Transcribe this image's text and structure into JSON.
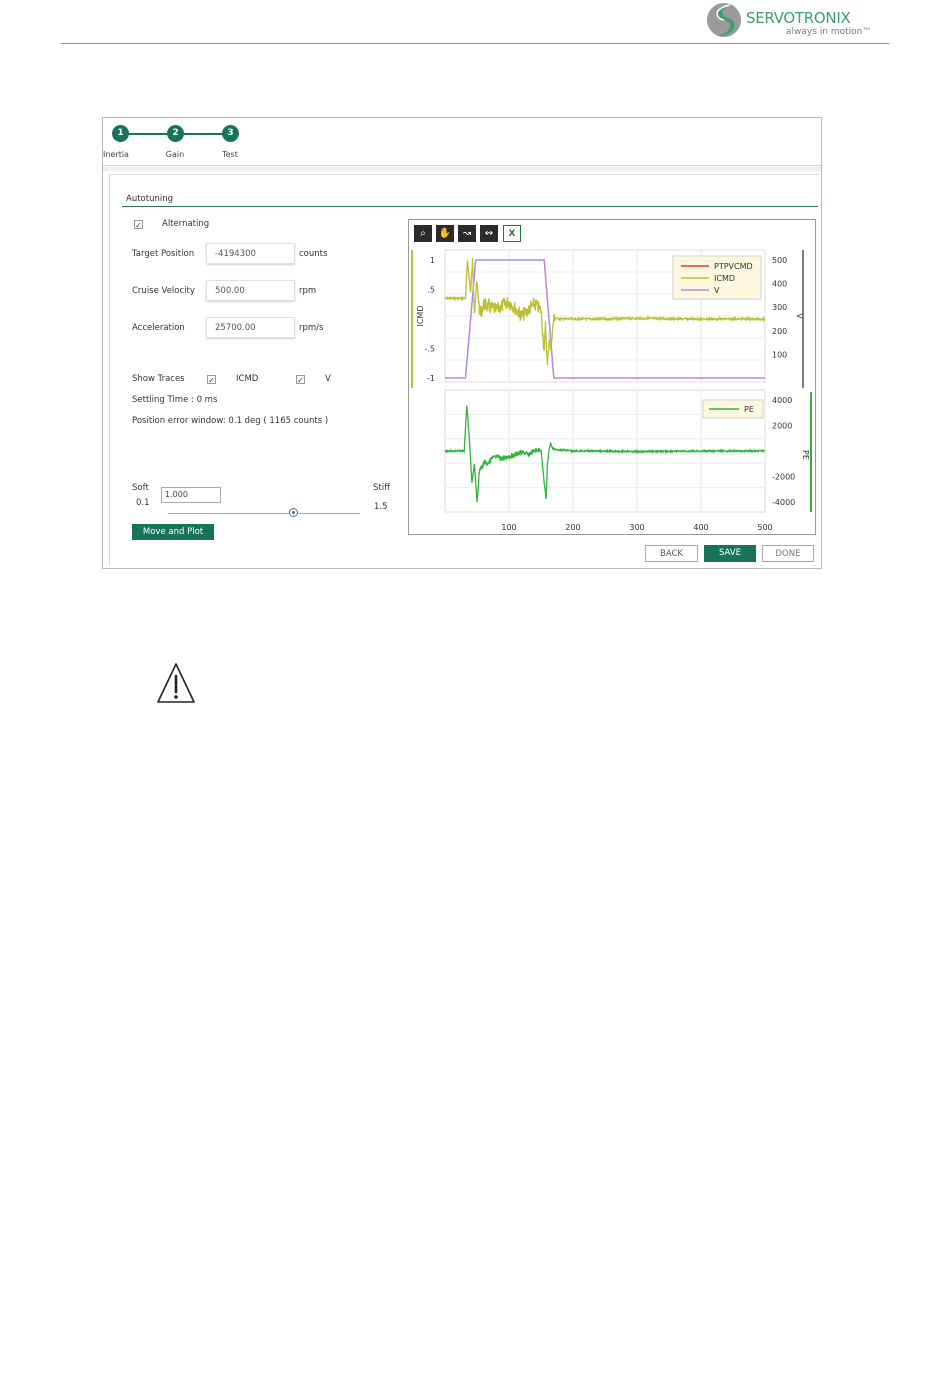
{
  "header": {
    "brand": "SERVOTRONIX",
    "tagline": "always in motion™",
    "colors": {
      "brand": "#3f9e6b",
      "accent": "#17745a"
    }
  },
  "wizard": {
    "steps": [
      {
        "number": "1",
        "label": "Inertia"
      },
      {
        "number": "2",
        "label": "Gain"
      },
      {
        "number": "3",
        "label": "Test"
      }
    ]
  },
  "autotuning": {
    "title": "Autotuning",
    "alternating": {
      "label": "Alternating",
      "checked": "✓"
    },
    "target_position": {
      "label": "Target Position",
      "value": "-4194300",
      "unit": "counts"
    },
    "cruise_velocity": {
      "label": "Cruise Velocity",
      "value": "500.00",
      "unit": "rpm"
    },
    "acceleration": {
      "label": "Acceleration",
      "value": "25700.00",
      "unit": "rpm/s"
    },
    "show_traces": {
      "label": "Show Traces",
      "icmd": {
        "label": "ICMD",
        "checked": "✓"
      },
      "v": {
        "label": "V",
        "checked": "✓"
      }
    },
    "settling_time": "Settling Time : 0 ms",
    "position_error_window": "Position error window: 0.1 deg ( 1165 counts )",
    "stiffness": {
      "soft_label": "Soft",
      "stiff_label": "Stiff",
      "min": "0.1",
      "max": "1.5",
      "value": "1.000",
      "slider_fraction": 0.65
    },
    "move_and_plot": "Move and Plot"
  },
  "chart_toolbar": {
    "icons": [
      "zoom-icon",
      "pan-hand-icon",
      "autoscale-icon",
      "fit-traces-icon",
      "excel-export-icon"
    ],
    "glyphs": [
      "⌕",
      "✋",
      "↝",
      "↭",
      "X"
    ]
  },
  "chart_data": [
    {
      "type": "line",
      "xlim": [
        0,
        500
      ],
      "ylabel": "ICMD",
      "ylim_left": [
        -1,
        1
      ],
      "left_ticks": [
        "1",
        ".5",
        "-.5",
        "-1"
      ],
      "y2label": "V",
      "ylim_right": [
        0,
        500
      ],
      "right_ticks": [
        "500",
        "400",
        "300",
        "200",
        "100"
      ],
      "legend_position": "top-right",
      "series": [
        {
          "name": "PTPVCMD",
          "color": "#e03a3a",
          "axis": "right",
          "x": [
            0,
            32,
            48,
            155,
            170,
            500
          ],
          "y": [
            0,
            0,
            500,
            500,
            0,
            0
          ]
        },
        {
          "name": "ICMD",
          "color": "#bcc034",
          "axis": "left",
          "x": [
            0,
            32,
            35,
            40,
            43,
            46,
            50,
            55,
            60,
            70,
            80,
            100,
            120,
            140,
            150,
            155,
            157,
            160,
            163,
            165,
            170,
            180,
            200,
            250,
            300,
            400,
            500
          ],
          "y": [
            0.35,
            0.35,
            1.0,
            0.45,
            0.95,
            0.2,
            0.6,
            0.05,
            0.25,
            0.2,
            0.15,
            0.3,
            0.05,
            0.25,
            0.15,
            -0.55,
            -0.1,
            -0.8,
            -0.3,
            -0.5,
            0.02,
            0.0,
            0.0,
            0.0,
            0.01,
            0.0,
            0.0
          ]
        },
        {
          "name": "V",
          "color": "#b48ee0",
          "axis": "right",
          "x": [
            0,
            32,
            48,
            155,
            170,
            500
          ],
          "y": [
            0,
            0,
            500,
            500,
            0,
            0
          ]
        }
      ]
    },
    {
      "type": "line",
      "xlim": [
        0,
        500
      ],
      "y2label": "PE",
      "ylim_right": [
        -4000,
        4000
      ],
      "right_ticks": [
        "4000",
        "2000",
        "-2000",
        "-4000"
      ],
      "x_ticks": [
        "100",
        "200",
        "300",
        "400",
        "500"
      ],
      "legend_position": "top-right",
      "series": [
        {
          "name": "PE",
          "color": "#33b33a",
          "axis": "right",
          "x": [
            0,
            30,
            34,
            38,
            42,
            46,
            50,
            54,
            58,
            62,
            66,
            70,
            80,
            90,
            100,
            110,
            120,
            130,
            140,
            150,
            155,
            158,
            160,
            163,
            165,
            168,
            172,
            180,
            200,
            250,
            300,
            400,
            500
          ],
          "y": [
            0,
            0,
            3600,
            1000,
            -2500,
            -1000,
            -4000,
            -1500,
            -1200,
            -800,
            -1000,
            -700,
            -500,
            -600,
            -400,
            -300,
            -100,
            -300,
            0,
            100,
            -2500,
            -3800,
            -1000,
            200,
            600,
            200,
            100,
            100,
            0,
            0,
            -50,
            0,
            0
          ]
        }
      ]
    }
  ],
  "buttons": {
    "back": "BACK",
    "save": "SAVE",
    "done": "DONE"
  }
}
